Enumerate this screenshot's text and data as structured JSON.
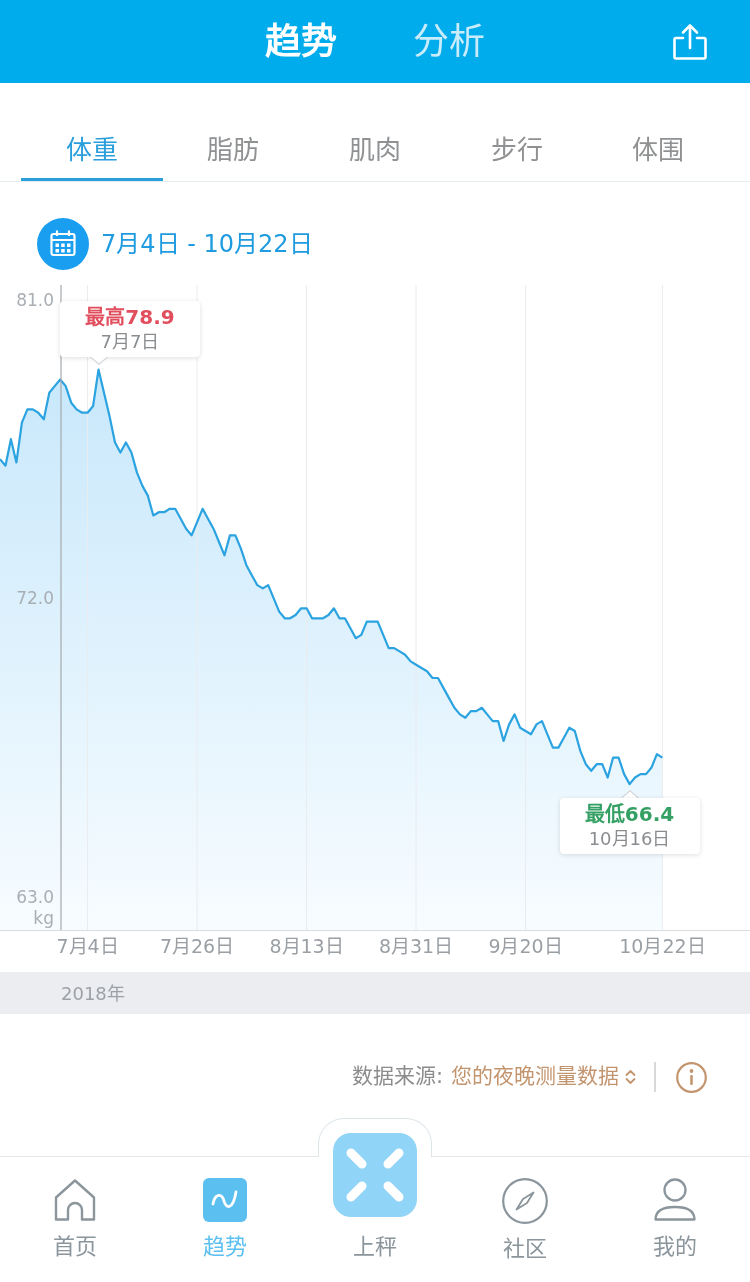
{
  "header": {
    "tabs": [
      {
        "label": "趋势",
        "selected": true
      },
      {
        "label": "分析",
        "selected": false
      }
    ]
  },
  "metric_tabs": [
    {
      "label": "体重",
      "selected": true
    },
    {
      "label": "脂肪",
      "selected": false
    },
    {
      "label": "肌肉",
      "selected": false
    },
    {
      "label": "步行",
      "selected": false
    },
    {
      "label": "体围",
      "selected": false
    }
  ],
  "date_range": "7月4日 - 10月22日",
  "chart": {
    "year": "2018年",
    "tooltips": [
      {
        "kind": "max",
        "label": "最高78.9",
        "date": "7月7日",
        "color": "#e14f5e"
      },
      {
        "kind": "min",
        "label": "最低66.4",
        "date": "10月16日",
        "color": "#35a064"
      }
    ],
    "chart_data": {
      "type": "area",
      "ylabel": "kg",
      "grid": true,
      "categories": [
        null,
        null,
        null,
        null,
        null,
        null,
        null,
        null,
        null,
        null,
        null,
        null,
        null,
        null,
        null,
        null,
        "7月4日",
        null,
        null,
        null,
        null,
        null,
        null,
        null,
        null,
        null,
        null,
        null,
        null,
        null,
        null,
        null,
        null,
        null,
        null,
        null,
        "7月26日",
        null,
        null,
        null,
        null,
        null,
        null,
        null,
        null,
        null,
        null,
        null,
        null,
        null,
        null,
        null,
        null,
        null,
        null,
        null,
        "8月13日",
        null,
        null,
        null,
        null,
        null,
        null,
        null,
        null,
        null,
        null,
        null,
        null,
        null,
        null,
        null,
        null,
        null,
        null,
        null,
        "8月31日",
        null,
        null,
        null,
        null,
        null,
        null,
        null,
        null,
        null,
        null,
        null,
        null,
        null,
        null,
        null,
        null,
        null,
        null,
        null,
        "9月20日",
        null,
        null,
        null,
        null,
        null,
        null,
        null,
        null,
        null,
        null,
        null,
        null,
        null,
        null,
        null,
        null,
        null,
        null,
        null,
        null,
        null,
        null,
        null,
        null,
        "10月22日",
        null,
        null,
        null,
        null,
        null,
        null,
        null,
        null,
        null,
        null,
        null,
        null,
        null,
        null,
        null,
        null
      ],
      "series": [
        {
          "values": [
            76.2,
            76.0,
            76.8,
            76.1,
            77.3,
            77.7,
            77.7,
            77.6,
            77.4,
            78.2,
            78.4,
            78.6,
            78.4,
            77.9,
            77.7,
            77.6,
            77.6,
            77.8,
            78.9,
            78.2,
            77.5,
            76.7,
            76.4,
            76.7,
            76.4,
            75.8,
            75.4,
            75.1,
            74.5,
            74.6,
            74.6,
            74.7,
            74.7,
            74.4,
            74.1,
            73.9,
            74.3,
            74.7,
            74.4,
            74.1,
            73.7,
            73.3,
            73.9,
            73.9,
            73.5,
            73.0,
            72.7,
            72.4,
            72.3,
            72.4,
            72.0,
            71.6,
            71.4,
            71.4,
            71.5,
            71.7,
            71.7,
            71.4,
            71.4,
            71.4,
            71.5,
            71.7,
            71.4,
            71.4,
            71.1,
            70.8,
            70.9,
            71.3,
            71.3,
            71.3,
            70.9,
            70.5,
            70.5,
            70.4,
            70.3,
            70.1,
            70.0,
            69.9,
            69.8,
            69.6,
            69.6,
            69.3,
            69.0,
            68.7,
            68.5,
            68.4,
            68.6,
            68.6,
            68.7,
            68.5,
            68.3,
            68.3,
            67.7,
            68.2,
            68.5,
            68.1,
            68.0,
            67.9,
            68.2,
            68.3,
            67.9,
            67.5,
            67.5,
            67.8,
            68.1,
            68.0,
            67.4,
            67.0,
            66.8,
            67.0,
            67.0,
            66.6,
            67.2,
            67.2,
            66.7,
            66.4,
            66.6,
            66.7,
            66.7,
            66.9,
            67.3,
            67.2,
            null,
            null,
            null,
            null,
            null,
            null,
            null,
            null,
            null,
            null,
            null,
            null,
            null,
            null,
            null,
            null
          ]
        }
      ],
      "ylim": [
        62,
        81.45
      ],
      "yticks": [
        {
          "value": 63,
          "label": "63.0"
        },
        {
          "value": 72,
          "label": "72.0"
        },
        {
          "value": 81,
          "label": "81.0"
        }
      ]
    }
  },
  "data_source": {
    "label": "数据来源:",
    "value": "您的夜晚测量数据"
  },
  "bottom_nav": [
    {
      "kind": "home",
      "label": "首页",
      "selected": false
    },
    {
      "kind": "trend",
      "label": "趋势",
      "selected": true
    },
    {
      "kind": "scale",
      "label": "上秤",
      "selected": false
    },
    {
      "kind": "compass",
      "label": "社区",
      "selected": false
    },
    {
      "kind": "profile",
      "label": "我的",
      "selected": false
    }
  ]
}
